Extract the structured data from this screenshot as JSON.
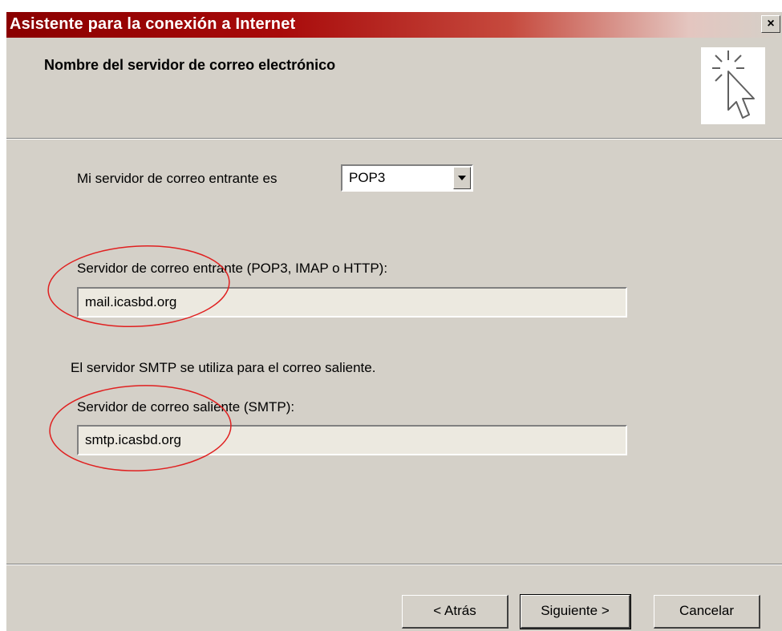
{
  "window": {
    "title": "Asistente para la conexión a Internet",
    "close_glyph": "×"
  },
  "header": {
    "title": "Nombre del servidor de correo electrónico",
    "icon": "wizard-cursor-icon"
  },
  "form": {
    "incoming_type_label": "Mi servidor de correo entrante es",
    "incoming_type_value": "POP3",
    "incoming_label": "Servidor de correo entrante (POP3, IMAP o HTTP):",
    "incoming_value": "mail.icasbd.org",
    "smtp_info": "El servidor SMTP se utiliza para el correo saliente.",
    "outgoing_label": "Servidor de correo saliente (SMTP):",
    "outgoing_value": "smtp.icasbd.org"
  },
  "buttons": {
    "back": "< Atrás",
    "next": "Siguiente >",
    "cancel": "Cancelar"
  },
  "colors": {
    "title_bar_start": "#8a0000",
    "dialog_face": "#d4d0c8",
    "annotation_circle": "#e02020"
  }
}
